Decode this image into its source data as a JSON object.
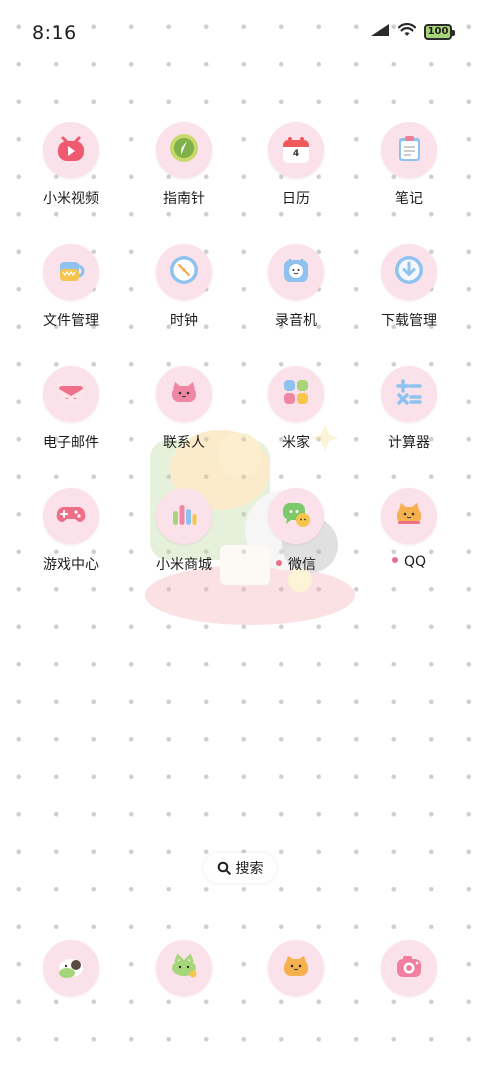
{
  "status_bar": {
    "time": "8:16",
    "battery": "100",
    "icons": [
      "signal-icon",
      "wifi-icon",
      "battery-icon"
    ]
  },
  "apps": [
    {
      "label": "小米视频",
      "icon": "video-icon"
    },
    {
      "label": "指南针",
      "icon": "compass-icon"
    },
    {
      "label": "日历",
      "icon": "calendar-icon",
      "calendar_day": "4"
    },
    {
      "label": "笔记",
      "icon": "notes-icon"
    },
    {
      "label": "文件管理",
      "icon": "folder-icon"
    },
    {
      "label": "时钟",
      "icon": "clock-icon"
    },
    {
      "label": "录音机",
      "icon": "recorder-icon"
    },
    {
      "label": "下载管理",
      "icon": "download-icon"
    },
    {
      "label": "电子邮件",
      "icon": "mail-icon"
    },
    {
      "label": "联系人",
      "icon": "contacts-icon"
    },
    {
      "label": "米家",
      "icon": "mijia-icon"
    },
    {
      "label": "计算器",
      "icon": "calculator-icon"
    },
    {
      "label": "游戏中心",
      "icon": "gamepad-icon"
    },
    {
      "label": "小米商城",
      "icon": "store-icon"
    },
    {
      "label": "微信",
      "icon": "wechat-icon",
      "notification_dot": true
    },
    {
      "label": "QQ",
      "icon": "qq-icon",
      "notification_dot": true
    }
  ],
  "search": {
    "label": "搜索"
  },
  "dock": [
    {
      "icon": "phone-icon"
    },
    {
      "icon": "messages-icon"
    },
    {
      "icon": "browser-icon"
    },
    {
      "icon": "camera-icon"
    }
  ],
  "colors": {
    "icon_background": "#fbe1ea",
    "notification_dot": "#ea6f8c",
    "battery_fill": "#a7d67a"
  }
}
